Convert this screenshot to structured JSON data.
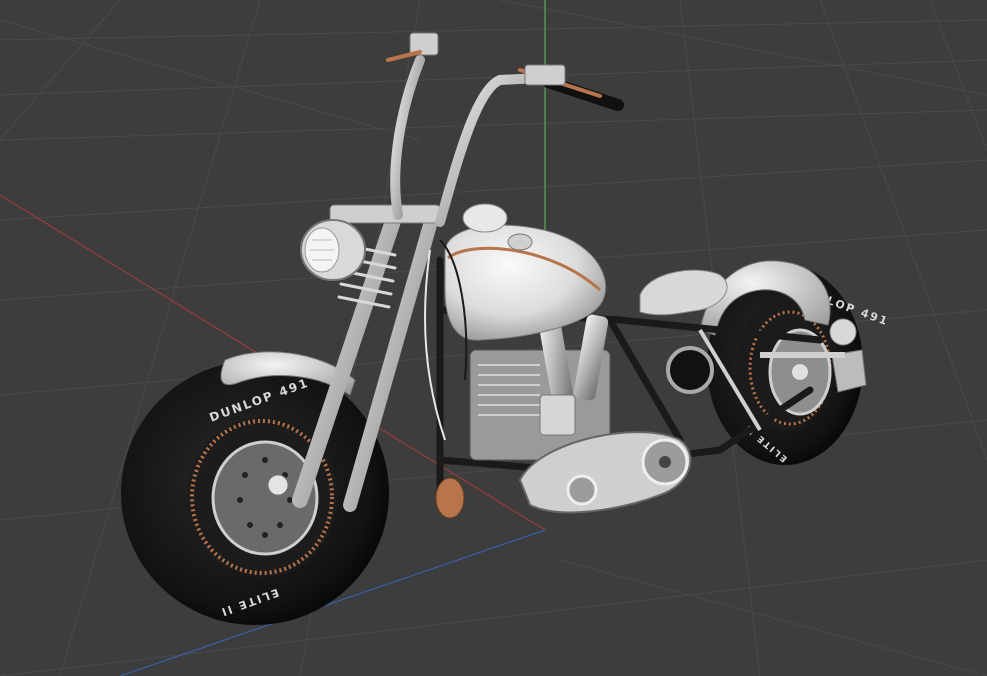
{
  "viewport": {
    "background": "#3d3d3d",
    "grid_color": "#4a4a4a",
    "x_axis_color": "#9a3b3b",
    "y_axis_color": "#3b5fa8",
    "z_axis_color": "#5fbf5f"
  },
  "model": {
    "name_icon": "motorcycle-model",
    "front_tire_brand": "DUNLOP 491",
    "front_tire_model": "ELITE II",
    "rear_tire_brand": "DUNLOP 491",
    "rear_tire_model": "ELITE II",
    "accent_color": "#b8744a",
    "body_color": "#e6e6e6",
    "tire_color": "#151515"
  }
}
